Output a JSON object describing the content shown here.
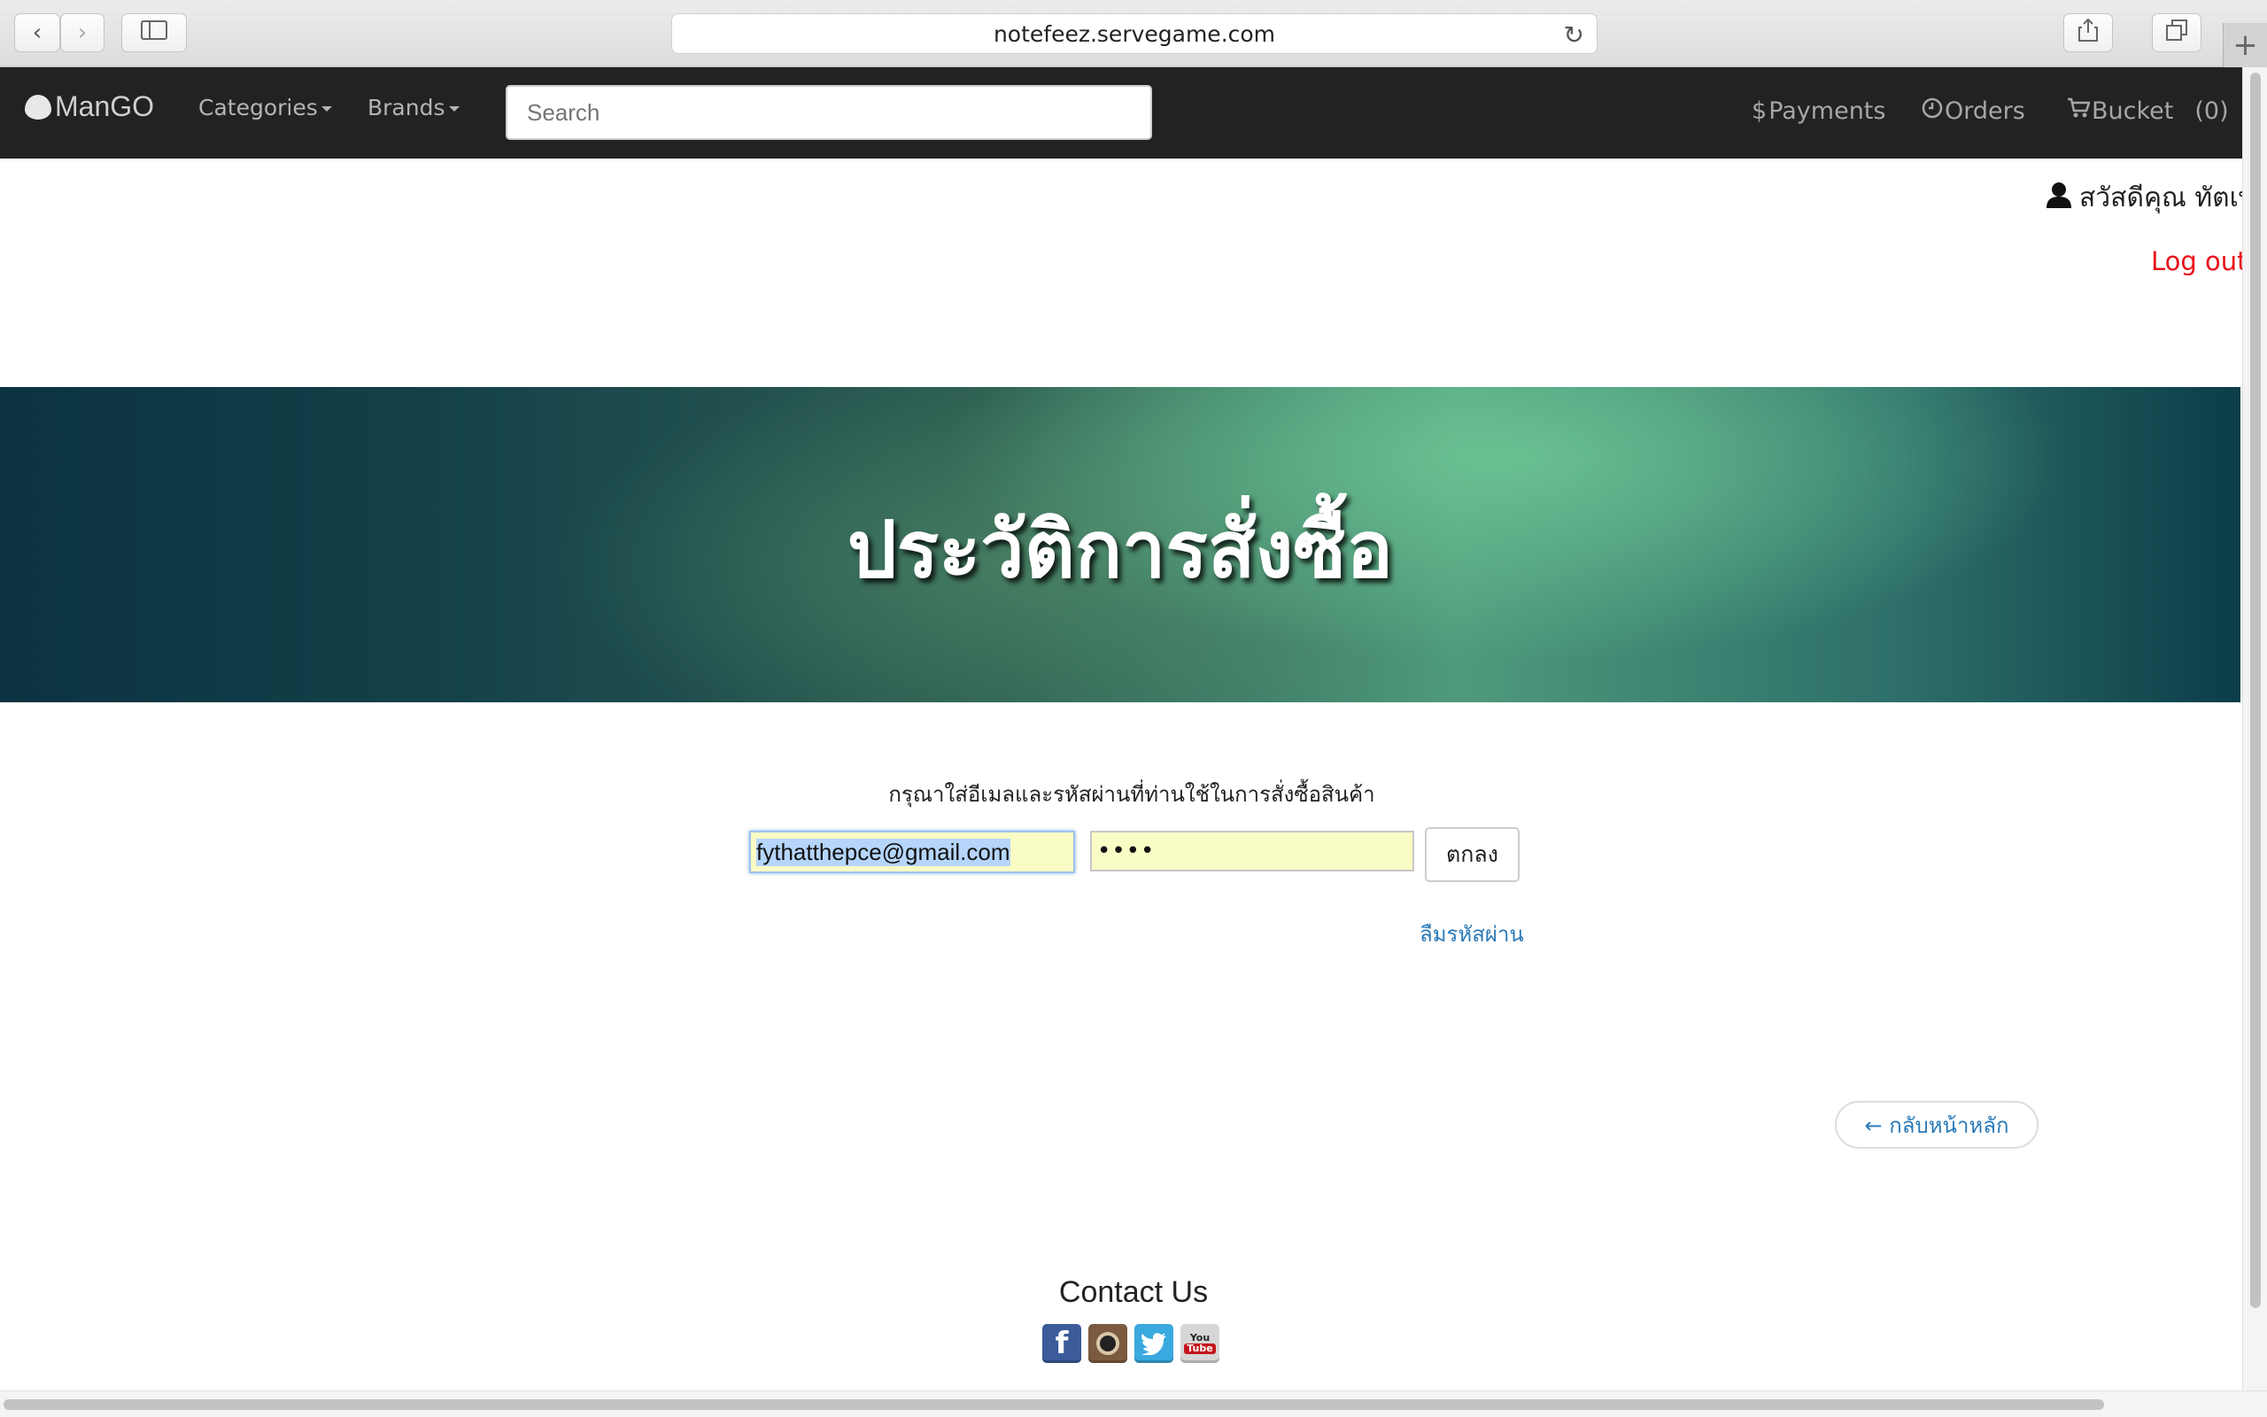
{
  "browser": {
    "url": "notefeez.servegame.com",
    "back_icon": "chevron-left-icon",
    "forward_icon": "chevron-right-icon",
    "sidebar_icon": "sidebar-icon",
    "reload_icon": "reload-icon",
    "share_icon": "share-icon",
    "tabs_icon": "tabs-icon",
    "newtab_icon": "plus-icon"
  },
  "navbar": {
    "brand": "ManGO",
    "categories": "Categories",
    "brands": "Brands",
    "search_placeholder": "Search",
    "payments": "Payments",
    "orders": "Orders",
    "bucket": "Bucket",
    "bucket_count": "(0)"
  },
  "user": {
    "greeting": "สวัสดีคุณ ทัตเพ",
    "logout": "Log out"
  },
  "banner": {
    "title": "ประวัติการสั่งซื้อ"
  },
  "login": {
    "prompt": "กรุณาใส่อีเมลและรหัสผ่านที่ท่านใช้ในการสั่งซื้อสินค้า",
    "email_value": "fythatthepce@gmail.com",
    "password_mask": "••••",
    "submit": "ตกลง",
    "forgot": "ลืมรหัสผ่าน"
  },
  "back_home": "← กลับหน้าหลัก",
  "footer": {
    "contact": "Contact Us",
    "social": [
      "facebook-icon",
      "instagram-icon",
      "twitter-icon",
      "youtube-icon"
    ],
    "youtube_text_top": "You",
    "youtube_text_bottom": "Tube"
  },
  "colors": {
    "navbar_bg": "#222222",
    "logout": "#e8101a",
    "link": "#2a7ab8",
    "autofill": "#fafcc6"
  }
}
